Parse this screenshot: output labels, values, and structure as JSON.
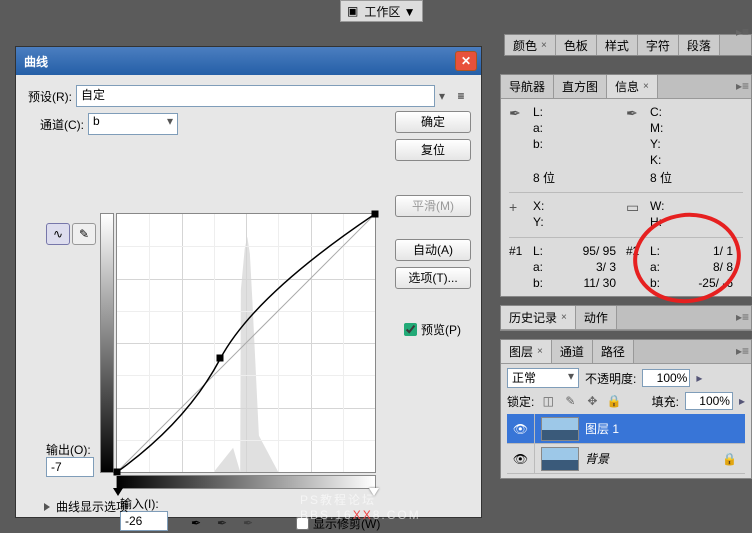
{
  "top_toolbar": {
    "workspace": "工作区 ▼"
  },
  "curves": {
    "title": "曲线",
    "preset_label": "预设(R):",
    "preset_value": "自定",
    "channel_label": "通道(C):",
    "channel_value": "b",
    "output_label": "输出(O):",
    "output_value": "-7",
    "input_label": "输入(I):",
    "input_value": "-26",
    "show_clip": "显示修剪(W)",
    "curve_display_options": "曲线显示选项",
    "buttons": {
      "ok": "确定",
      "cancel": "复位",
      "smooth": "平滑(M)",
      "auto": "自动(A)",
      "options": "选项(T)...",
      "preview": "预览(P)"
    }
  },
  "color_tabs": {
    "color": "颜色",
    "swatches": "色板",
    "styles": "样式",
    "character": "字符",
    "paragraph": "段落"
  },
  "nav_tabs": {
    "navigator": "导航器",
    "histogram": "直方图",
    "info": "信息"
  },
  "info": {
    "lab": {
      "L": "L:",
      "a": "a:",
      "b": "b:"
    },
    "cmyk": {
      "C": "C:",
      "M": "M:",
      "Y": "Y:",
      "K": "K:"
    },
    "bit": "8 位",
    "xy": {
      "X": "X:",
      "Y": "Y:"
    },
    "wh": {
      "W": "W:",
      "H": "H:"
    },
    "s1": {
      "label": "#1",
      "L": "95/  95",
      "a": "3/    3",
      "b": "11/  30"
    },
    "s2": {
      "label": "#2",
      "L": "1/    1",
      "a": "8/    8",
      "b": "-25/   -6"
    }
  },
  "history_tabs": {
    "history": "历史记录",
    "actions": "动作"
  },
  "layer_tabs": {
    "layers": "图层",
    "channels": "通道",
    "paths": "路径"
  },
  "layers": {
    "blend_mode": "正常",
    "opacity_label": "不透明度:",
    "opacity_value": "100%",
    "lock_label": "锁定:",
    "fill_label": "填充:",
    "fill_value": "100%",
    "layer1": "图层 1",
    "background": "背景"
  },
  "watermark": {
    "line1": "PS教程论坛",
    "line2_a": "BBS.16",
    "line2_b": "XX",
    "line2_c": "8.COM"
  }
}
